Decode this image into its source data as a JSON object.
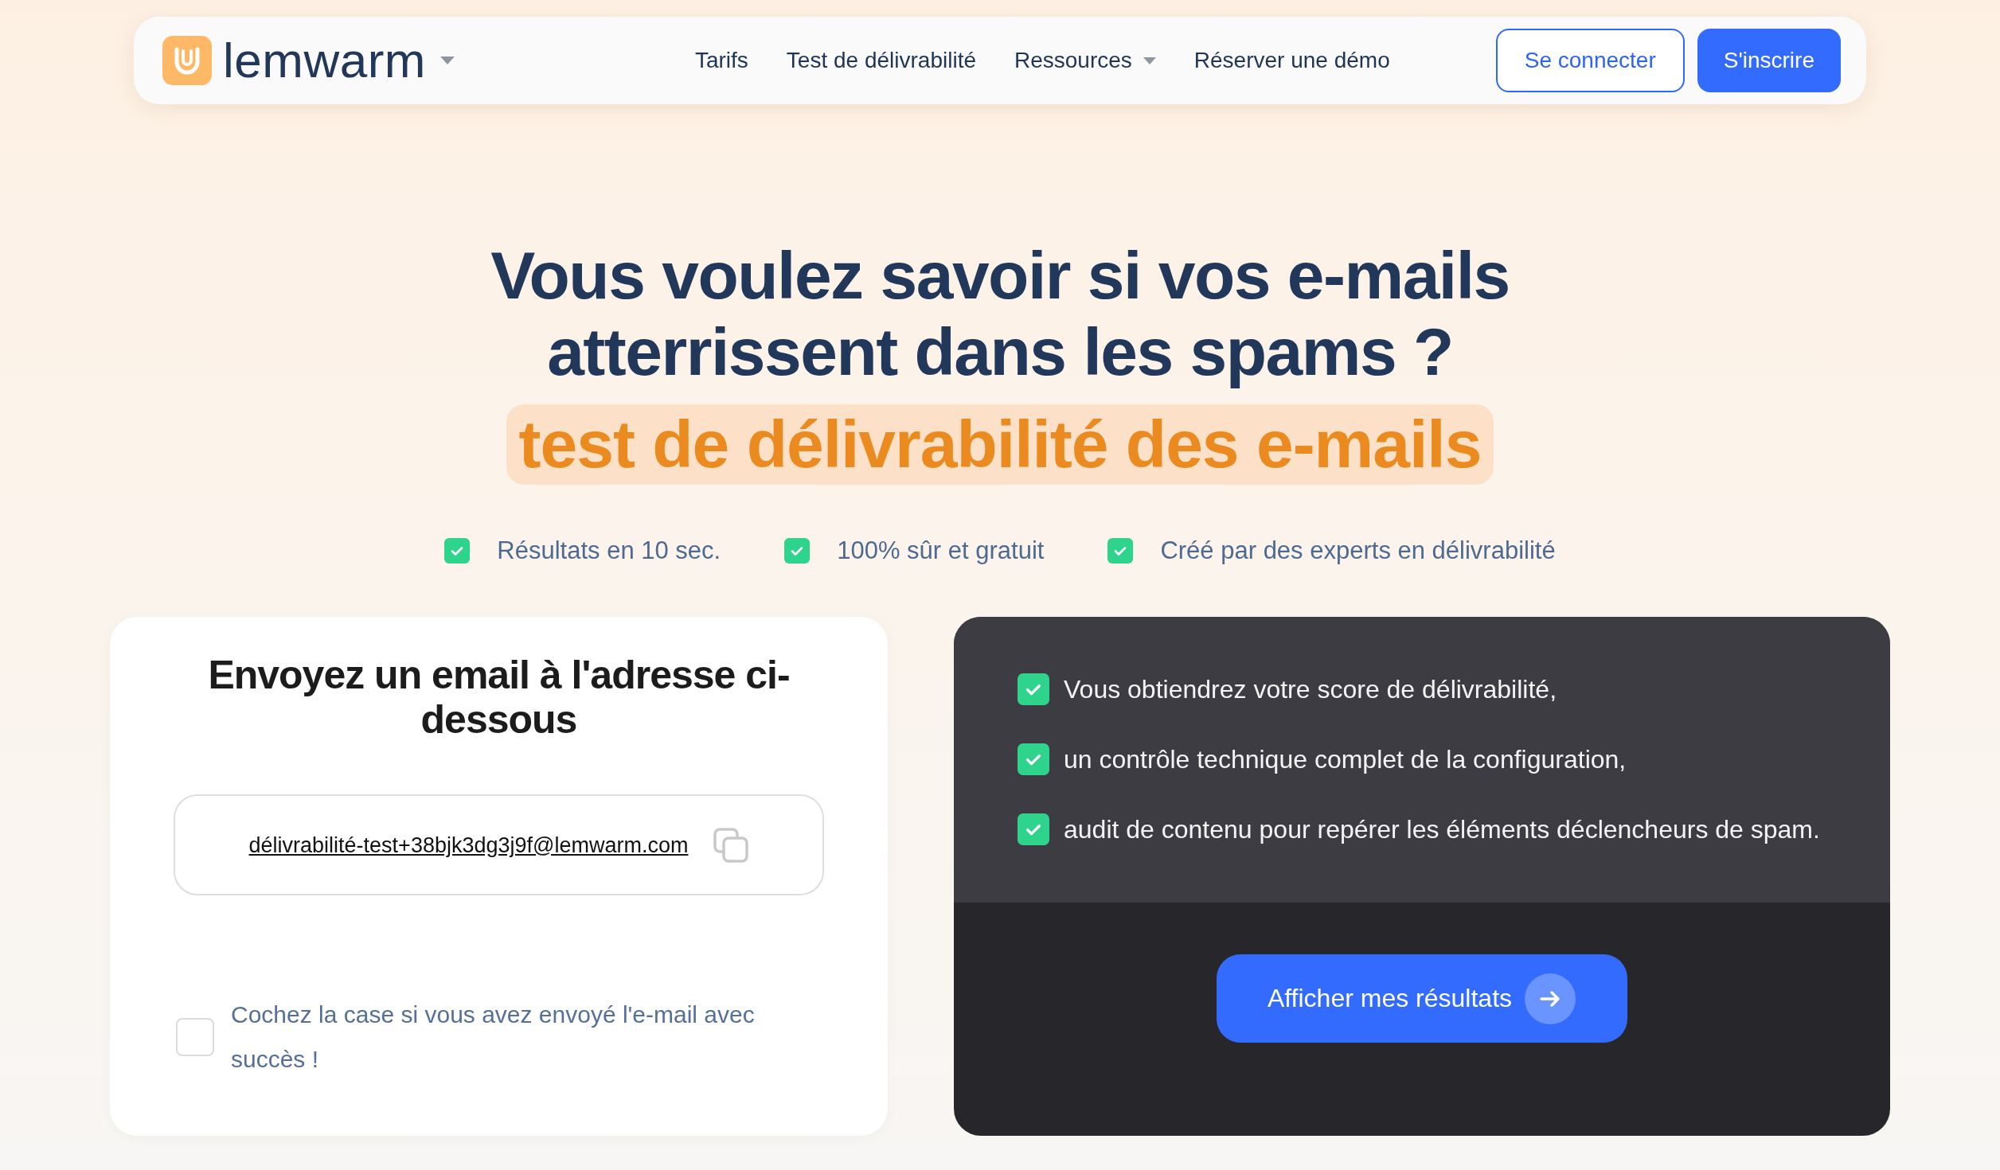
{
  "nav": {
    "logo": "lemwarm",
    "links": [
      {
        "label": "Tarifs",
        "kind": "link"
      },
      {
        "label": "Test de délivrabilité",
        "kind": "link"
      },
      {
        "label": "Ressources",
        "kind": "menu"
      },
      {
        "label": "Réserver une démo",
        "kind": "link"
      }
    ],
    "login_button": "Se connecter",
    "signup_button": "S'inscrire"
  },
  "hero": {
    "title": "Vous voulez savoir si vos e-mails atterrissent dans les spams ?",
    "highlight": "test de délivrabilité des e-mails",
    "benefits": [
      "Résultats en 10 sec.",
      "100% sûr et gratuit",
      "Créé par des experts en délivrabilité"
    ]
  },
  "send_card": {
    "title": "Envoyez un email à l'adresse ci-dessous",
    "address": "délivrabilité-test+38bjk3dg3j9f@lemwarm.com",
    "confirm": {
      "label": "Cochez la case si vous avez envoyé l'e-mail avec succès !",
      "checked": false
    }
  },
  "results_card": {
    "features": [
      "Vous obtiendrez votre score de délivrabilité,",
      "un contrôle technique complet de la configuration,",
      "audit de contenu pour repérer les éléments déclencheurs de spam."
    ],
    "button": "Afficher mes résultats"
  }
}
